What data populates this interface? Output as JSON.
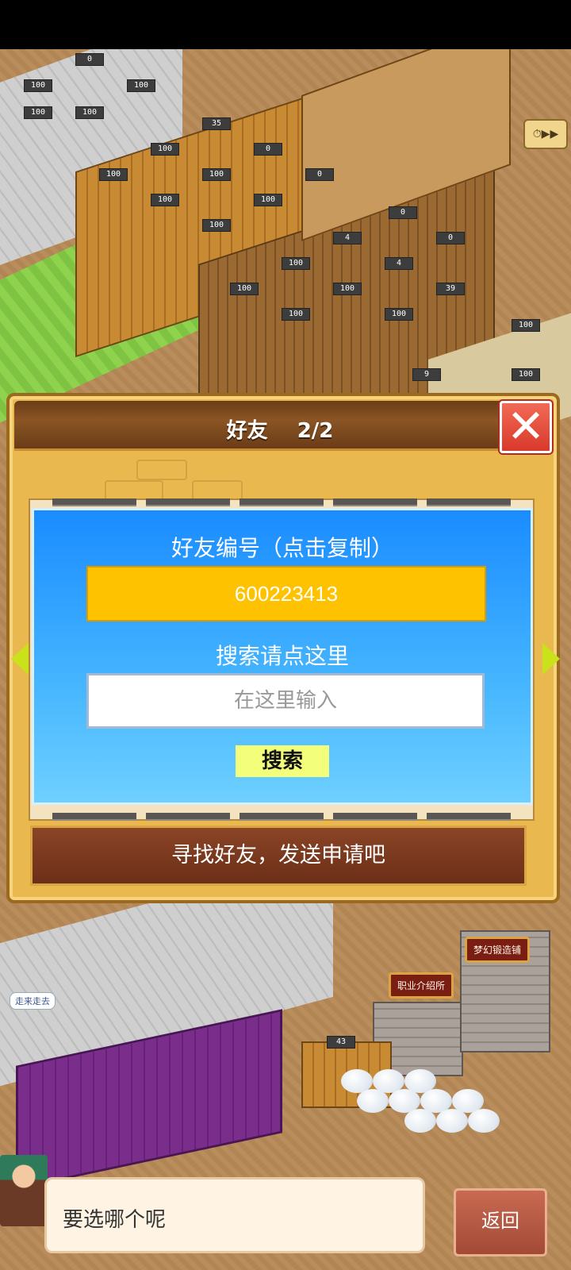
{
  "game_world": {
    "plot_counters": [
      "100",
      "0",
      "100",
      "100",
      "35",
      "100",
      "0",
      "100",
      "100",
      "0",
      "100",
      "100",
      "100",
      "100",
      "0",
      "4",
      "0",
      "100",
      "4",
      "100",
      "100",
      "100",
      "39",
      "100",
      "100",
      "9",
      "100",
      "43"
    ],
    "building_signs": {
      "forge": "梦幻锻造铺",
      "job_agency": "职业介绍所"
    },
    "walk_label": "走来走去"
  },
  "dialog": {
    "title": "好友",
    "page": "2/2",
    "close_symbol": "✕",
    "friend_id_label": "好友编号（点击复制）",
    "friend_id": "600223413",
    "search_hint": "搜索请点这里",
    "search_placeholder": "在这里输入",
    "search_button": "搜索",
    "find_friends_banner": "寻找好友，发送申请吧"
  },
  "bottom": {
    "prompt": "要选哪个呢",
    "back_button": "返回"
  },
  "colors": {
    "panel_blue": "#1a8cff",
    "id_box": "#ffc200",
    "search_button": "#f3ff7a",
    "close_red": "#e24a38",
    "banner_brown": "#6b2f17"
  }
}
